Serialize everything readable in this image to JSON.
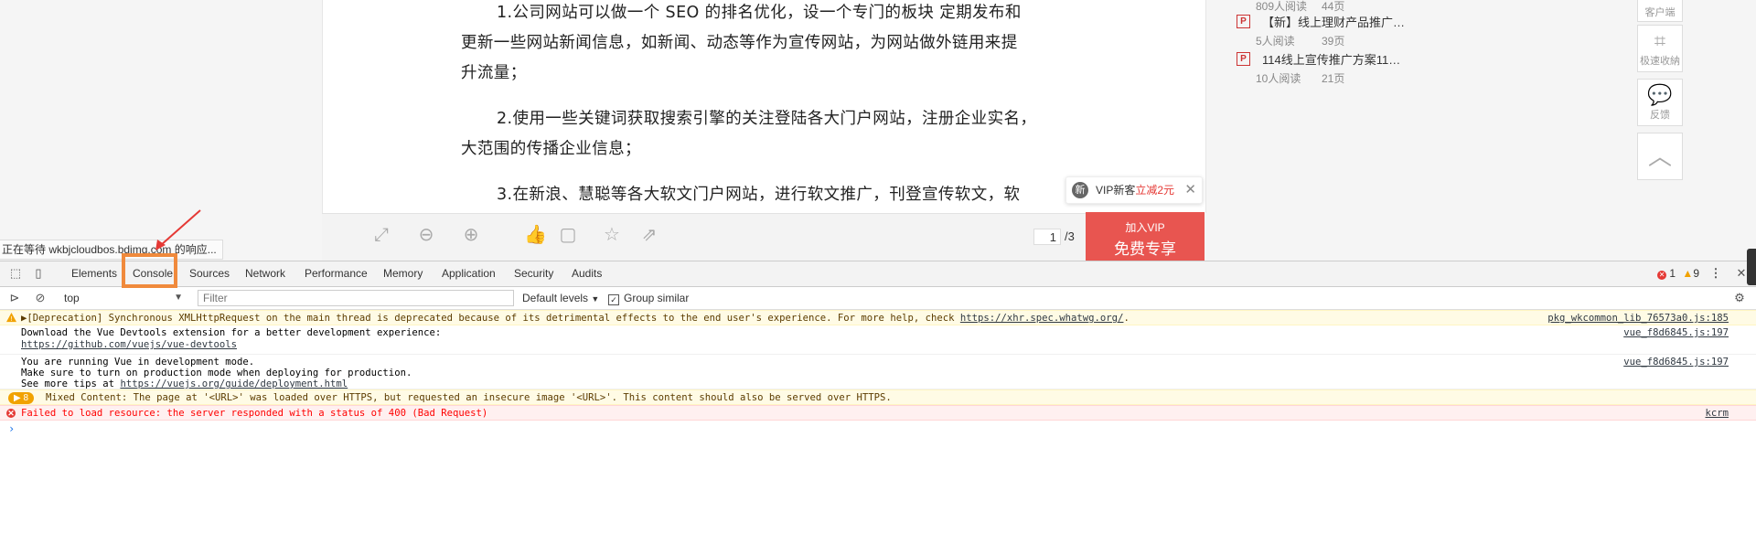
{
  "doc": {
    "paragraphs": [
      {
        "lines": [
          "1.公司网站可以做一个 SEO 的排名优化，设一个专门的板块 定期发布和",
          "更新一些网站新闻信息，如新闻、动态等作为宣传网站，为网站做外链用来提",
          "升流量；"
        ]
      },
      {
        "lines": [
          "2.使用一些关键词获取搜索引擎的关注登陆各大门户网站，注册企业实名，",
          "大范围的传播企业信息；"
        ]
      },
      {
        "lines": [
          "3.在新浪、慧聪等各大软文门户网站，进行软文推广，刊登宣传软文，软"
        ]
      }
    ],
    "toolbar": {
      "icons": [
        "fullscreen-icon",
        "zoom-out-icon",
        "zoom-in-icon",
        "like-icon",
        "comment-icon",
        "star-icon",
        "share-icon"
      ],
      "current_page": "1",
      "total_pages": "/3"
    },
    "vip_tip": {
      "badge": "新",
      "text": "VIP新客",
      "highlight": "立减2元",
      "close": "✕"
    },
    "vip_button": {
      "line1": "加入VIP",
      "line2": "免费专享"
    }
  },
  "sidebar": {
    "items": [
      {
        "icon": "P",
        "title": "",
        "reads": "809人阅读",
        "pages": "44页"
      },
      {
        "icon": "P",
        "title": "【新】线上理财产品推广…",
        "reads": "5人阅读",
        "pages": "39页"
      },
      {
        "icon": "P",
        "title": "114线上宣传推广方案11…",
        "reads": "10人阅读",
        "pages": "21页"
      }
    ]
  },
  "side_tools": [
    {
      "label": "客户端",
      "icon": "client-icon"
    },
    {
      "label": "极速收納",
      "icon": "crop-icon"
    },
    {
      "label": "反馈",
      "icon": "feedback-icon"
    },
    {
      "label": "",
      "icon": "back-to-top-icon"
    }
  ],
  "loading_status": "正在等待 wkbjcloudbos.bdimg.com 的响应...",
  "devtools": {
    "tabs": [
      "Elements",
      "Console",
      "Sources",
      "Network",
      "Performance",
      "Memory",
      "Application",
      "Security",
      "Audits"
    ],
    "active_tab": "Console",
    "error_count": "1",
    "warning_count": "9",
    "context": "top",
    "filter_placeholder": "Filter",
    "levels": "Default levels",
    "group_similar": "Group similar",
    "messages": [
      {
        "type": "warn",
        "lines": [
          "▶[Deprecation] Synchronous XMLHttpRequest on the main thread is deprecated because of its detrimental effects to the end user's experience. For more help, check "
        ],
        "link": "https://xhr.spec.whatwg.org/",
        "link_suffix": ".",
        "source": "pkg_wkcommon_lib_76573a0.js:185"
      },
      {
        "type": "log",
        "lines": [
          "Download the Vue Devtools extension for a better development experience:"
        ],
        "link": "https://github.com/vuejs/vue-devtools",
        "source": "vue_f8d6845.js:197"
      },
      {
        "type": "log",
        "lines": [
          "You are running Vue in development mode.",
          "Make sure to turn on production mode when deploying for production."
        ],
        "link_prefix": "See more tips at ",
        "link": "https://vuejs.org/guide/deployment.html",
        "source": "vue_f8d6845.js:197"
      },
      {
        "type": "warn-group",
        "count": "▶ 8",
        "lines": [
          "Mixed Content: The page at '<URL>' was loaded over HTTPS, but requested an insecure image '<URL>'. This content should also be served over HTTPS."
        ]
      },
      {
        "type": "err",
        "lines": [
          "Failed to load resource: the server responded with a status of 400 (Bad Request)"
        ],
        "source": "kcrm"
      }
    ],
    "prompt": "›"
  }
}
